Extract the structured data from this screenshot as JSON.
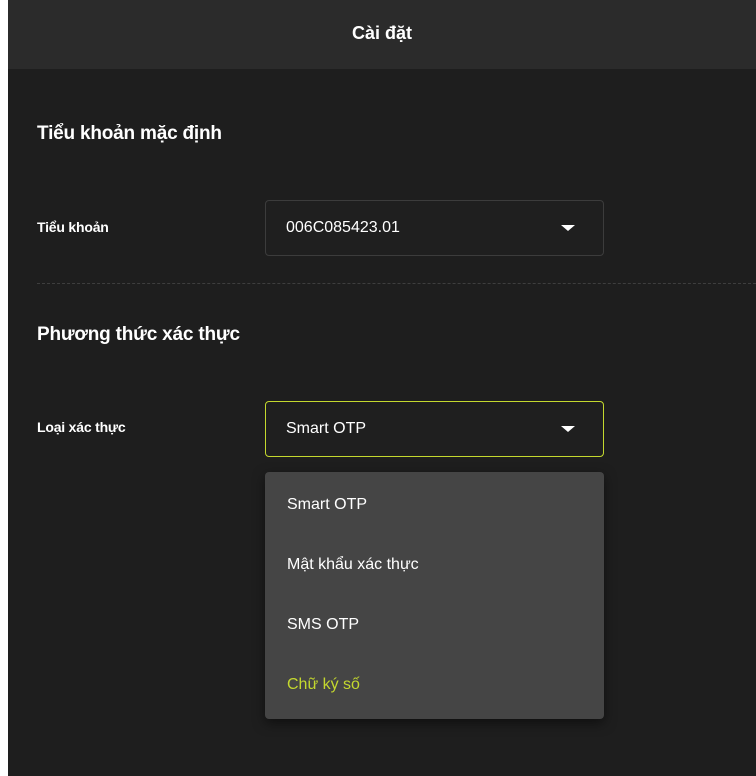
{
  "header": {
    "title": "Cài đặt"
  },
  "default_account": {
    "section_title": "Tiểu khoản mặc định",
    "label": "Tiểu khoản",
    "selected_value": "006C085423.01"
  },
  "auth_method": {
    "section_title": "Phương thức xác thực",
    "label": "Loại xác thực",
    "selected_value": "Smart OTP",
    "options": [
      {
        "label": "Smart OTP"
      },
      {
        "label": "Mật khẩu xác thực"
      },
      {
        "label": "SMS OTP"
      },
      {
        "label": "Chữ ký số"
      }
    ]
  },
  "colors": {
    "background": "#1e1e1e",
    "header": "#2b2b2b",
    "accent": "#c4d82e",
    "menu": "#454545"
  }
}
